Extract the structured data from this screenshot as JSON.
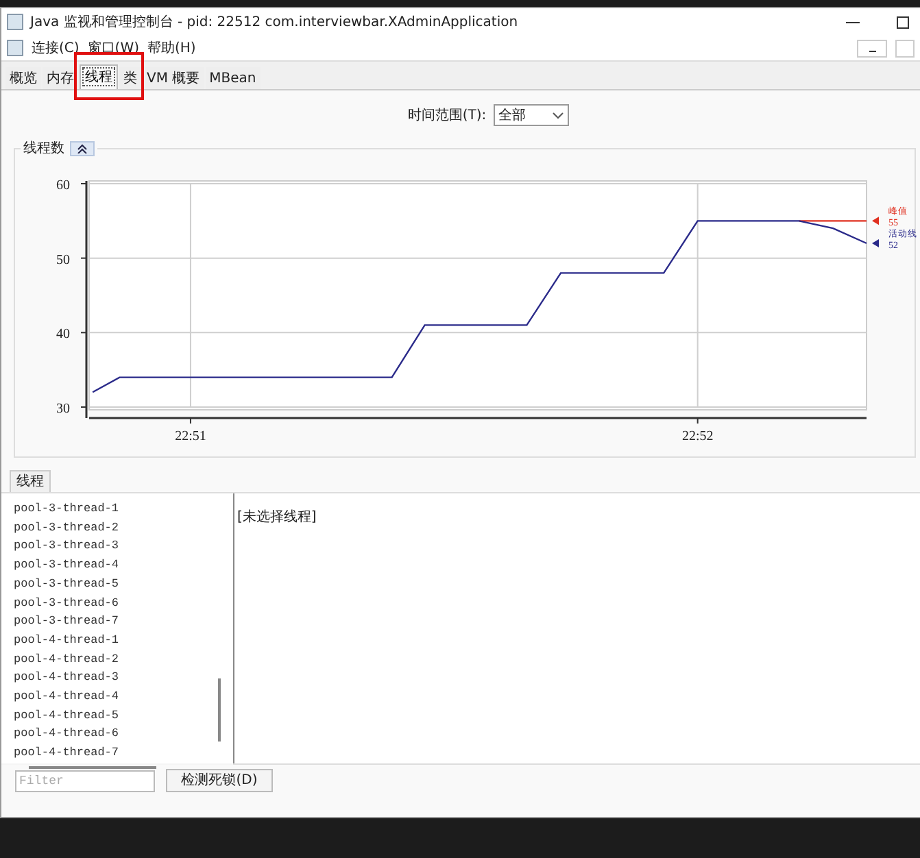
{
  "window": {
    "title": "Java 监视和管理控制台 - pid: 22512 com.interviewbar.XAdminApplication"
  },
  "menu": [
    {
      "label": "连接(C)"
    },
    {
      "label": "窗口(W)"
    },
    {
      "label": "帮助(H)"
    }
  ],
  "tabs": [
    {
      "label": "概览",
      "selected": false
    },
    {
      "label": "内存",
      "selected": false
    },
    {
      "label": "线程",
      "selected": true
    },
    {
      "label": "类",
      "selected": false
    },
    {
      "label": "VM 概要",
      "selected": false
    },
    {
      "label": "MBean",
      "selected": false
    }
  ],
  "time_range": {
    "label": "时间范围(T):",
    "value": "全部"
  },
  "thread_count_panel": {
    "title": "线程数",
    "expanded": true,
    "chart_data": {
      "type": "line",
      "grid": true,
      "x": [
        1370.807,
        1370.86,
        1371.397,
        1371.462,
        1371.663,
        1371.73,
        1371.933,
        1372,
        1372.2,
        1372.267,
        1372.333
      ],
      "series": [
        {
          "name": "峰值",
          "color": "#e03020",
          "values": [
            null,
            null,
            null,
            null,
            null,
            null,
            null,
            null,
            55,
            55,
            55
          ]
        },
        {
          "name": "活动线",
          "color": "#2a2a8a",
          "values": [
            32,
            34,
            34,
            41,
            41,
            48,
            48,
            55,
            55,
            54,
            52
          ]
        }
      ],
      "xlim": [
        1370.8,
        1372.333
      ],
      "ylim": [
        30,
        60
      ],
      "xticks": [
        {
          "value": 1371,
          "label": "22:51"
        },
        {
          "value": 1372,
          "label": "22:52"
        }
      ],
      "yticks": [
        30,
        40,
        50,
        60
      ],
      "annotations": [
        {
          "text": "55"
        },
        {
          "text": "52"
        }
      ]
    }
  },
  "threads_section": {
    "tab": "线程",
    "threads": [
      "pool-3-thread-1",
      "pool-3-thread-2",
      "pool-3-thread-3",
      "pool-3-thread-4",
      "pool-3-thread-5",
      "pool-3-thread-6",
      "pool-3-thread-7",
      "pool-4-thread-1",
      "pool-4-thread-2",
      "pool-4-thread-3",
      "pool-4-thread-4",
      "pool-4-thread-5",
      "pool-4-thread-6",
      "pool-4-thread-7"
    ],
    "detail": "[未选择线程]",
    "filter": {
      "placeholder": "Filter"
    },
    "deadlock_button": "检测死锁(D)"
  }
}
